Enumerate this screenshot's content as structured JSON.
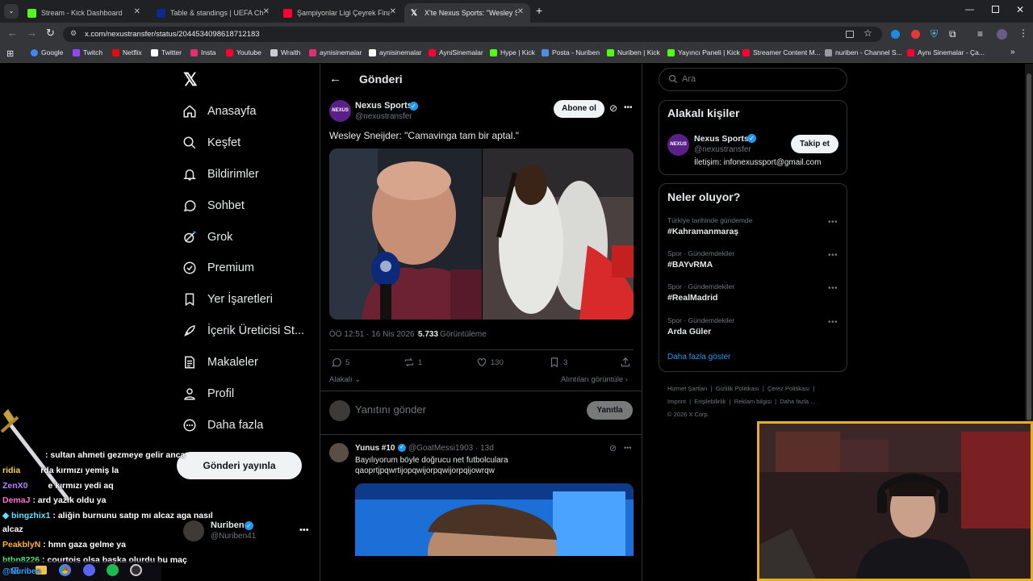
{
  "browser": {
    "tabs": [
      {
        "title": "Stream - Kick Dashboard",
        "favicon_color": "#53fc18"
      },
      {
        "title": "Table & standings | UEFA Cham",
        "favicon_color": "#0b2a8a"
      },
      {
        "title": "Şampiyonlar Ligi Çeyrek Final |",
        "favicon_color": "#ff0033"
      },
      {
        "title": "X'te Nexus Sports: \"Wesley Snei",
        "favicon_color": "#ffffff"
      }
    ],
    "url": "x.com/nexustransfer/status/2044534098618712183",
    "bookmarks": [
      {
        "label": "Google",
        "color": "#4285f4"
      },
      {
        "label": "Twitch",
        "color": "#9146ff"
      },
      {
        "label": "Netflix",
        "color": "#e50914"
      },
      {
        "label": "Twitter",
        "color": "#ffffff"
      },
      {
        "label": "Insta",
        "color": "#e1306c"
      },
      {
        "label": "Youtube",
        "color": "#ff0033"
      },
      {
        "label": "Wraith",
        "color": "#cccccc"
      },
      {
        "label": "aynisinemalar",
        "color": "#e1306c"
      },
      {
        "label": "aynisinemalar",
        "color": "#ffffff"
      },
      {
        "label": "AyniSinemalar",
        "color": "#ff0033"
      },
      {
        "label": "Hype | Kick",
        "color": "#53fc18"
      },
      {
        "label": "Posta - Nuriben",
        "color": "#4a90e2"
      },
      {
        "label": "Nuriben | Kick",
        "color": "#53fc18"
      },
      {
        "label": "Yayıncı Paneli | Kick",
        "color": "#53fc18"
      },
      {
        "label": "Streamer Content M...",
        "color": "#ff0033"
      },
      {
        "label": "nuriben - Channel S...",
        "color": "#999999"
      },
      {
        "label": "Aynı Sinemalar - Ça...",
        "color": "#ff0033"
      }
    ]
  },
  "nav": {
    "items": [
      "Anasayfa",
      "Keşfet",
      "Bildirimler",
      "Sohbet",
      "Grok",
      "Premium",
      "Yer İşaretleri",
      "İçerik Üreticisi St...",
      "Makaleler",
      "Profil",
      "Daha fazla"
    ],
    "post_button": "Gönderi yayınla",
    "account": {
      "name": "Nuriben",
      "handle": "@Nuriben41"
    }
  },
  "post": {
    "header": "Gönderi",
    "author": {
      "name": "Nexus Sports",
      "handle": "@nexustransfer",
      "avatar_text": "NEXUS"
    },
    "subscribe": "Abone ol",
    "text": "Wesley Sneijder: \"Camavinga tam bir aptal.\"",
    "time": "ÖÖ 12:51 · 16 Nis 2026 ·",
    "views_count": "5.733",
    "views_label": "Görüntüleme",
    "stats": {
      "replies": "5",
      "reposts": "1",
      "likes": "130",
      "bookmarks": "3"
    },
    "sort": "Alakalı",
    "quotes": "Alıntıları görüntüle",
    "reply_placeholder": "Yanıtını gönder",
    "reply_button": "Yanıtla"
  },
  "reply": {
    "name": "Yunus #10",
    "handle": "@GoatMessi1903 · 13d",
    "text_line1": "Bayılıyorum böyle  doğrucu net futbolculara",
    "text_line2": "qaoprtjpqwrtijopqwijorpqwijorpqijowrqw"
  },
  "search": {
    "placeholder": "Ara"
  },
  "relevant": {
    "title": "Alakalı kişiler",
    "name": "Nexus Sports",
    "handle": "@nexustransfer",
    "bio": "İletişim: infonexussport@gmail.com",
    "follow": "Takip et"
  },
  "trends": {
    "title": "Neler oluyor?",
    "items": [
      {
        "category": "Türkiye tarihinde gündemde",
        "tag": "#Kahramanmaraş"
      },
      {
        "category": "Spor · Gündemdekiler",
        "tag": "#BAYvRMA"
      },
      {
        "category": "Spor · Gündemdekiler",
        "tag": "#RealMadrid"
      },
      {
        "category": "Spor · Gündemdekiler",
        "tag": "Arda Güler"
      }
    ],
    "more": "Daha fazla göster"
  },
  "footer": {
    "links": [
      "Hizmet Şartları",
      "Gizlilik Politikası",
      "Çerez Politikası",
      "Imprint",
      "Erişilebilirlik",
      "Reklam bilgisi",
      "Daha fazla ..."
    ],
    "copyright": "© 2026 X Corp."
  },
  "chat": [
    {
      "user": "",
      "msg": ": sultan ahmeti gezmeye gelir anca",
      "color": "#3aa0ff"
    },
    {
      "user": "ridia",
      "msg": "rda kırmızı yemiş la",
      "color": "#ffd23c"
    },
    {
      "user": "ZenX0",
      "msg": "e kırmızı yedi aq",
      "color": "#b980ff"
    },
    {
      "user": "DemaJ",
      "msg": ": ard     yazık oldu ya",
      "color": "#ff6ad5"
    },
    {
      "user": "bingzhix1",
      "msg": ": aliğin burnunu satıp mı alcaz aga nasıl",
      "color": "#5ee3ff"
    },
    {
      "user": "",
      "msg": "alcaz",
      "color": "#ffffff"
    },
    {
      "user": "PeakblyN",
      "msg": ": hmn gaza gelme ya",
      "color": "#ffb13b"
    },
    {
      "user": "btbn8226",
      "msg": ": courtois olsa başka olurdu bu maç",
      "color": "#54e07b"
    },
    {
      "user": "@Nuriben",
      "msg": "",
      "color": "#3aa0ff"
    }
  ],
  "colors": {
    "accent": "#1d9bf0",
    "background": "#000000",
    "border": "#2f3336"
  }
}
